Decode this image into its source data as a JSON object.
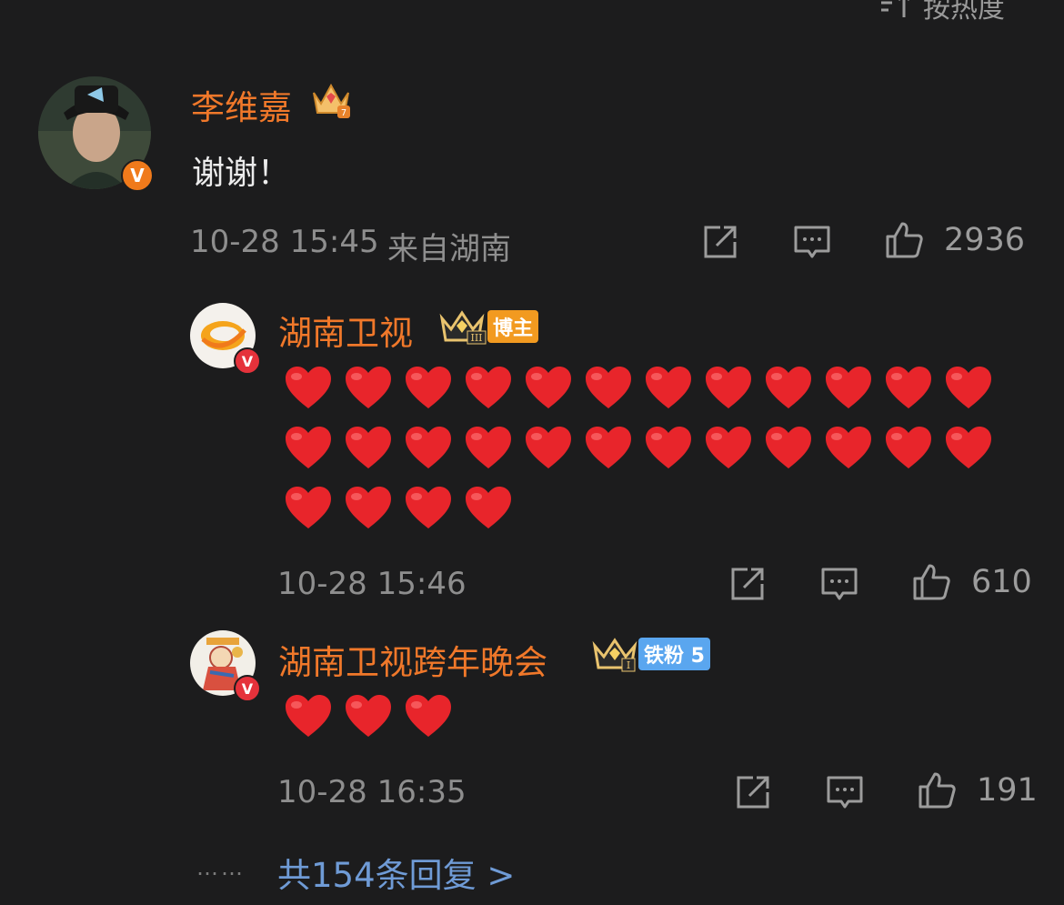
{
  "sort": {
    "label": "按热度",
    "icon": "sort-icon"
  },
  "main_comment": {
    "username": "李维嘉",
    "text": "谢谢！",
    "time": "10-28 15:45",
    "location": "来自湖南",
    "likes": "2936",
    "badge": "crown-level-icon"
  },
  "replies": [
    {
      "username": "湖南卫视",
      "badge_label": "博主",
      "time": "10-28 15:46",
      "likes": "610",
      "hearts": 28
    },
    {
      "username": "湖南卫视跨年晚会",
      "badge_label": "铁粉 5",
      "time": "10-28 16:35",
      "likes": "191",
      "hearts": 3
    }
  ],
  "more_replies": {
    "dots": "……",
    "label": "共154条回复 >"
  },
  "colors": {
    "username": "#f0782a",
    "link": "#6f9bd6",
    "heart": "#e8252b",
    "background": "#1c1c1d"
  }
}
